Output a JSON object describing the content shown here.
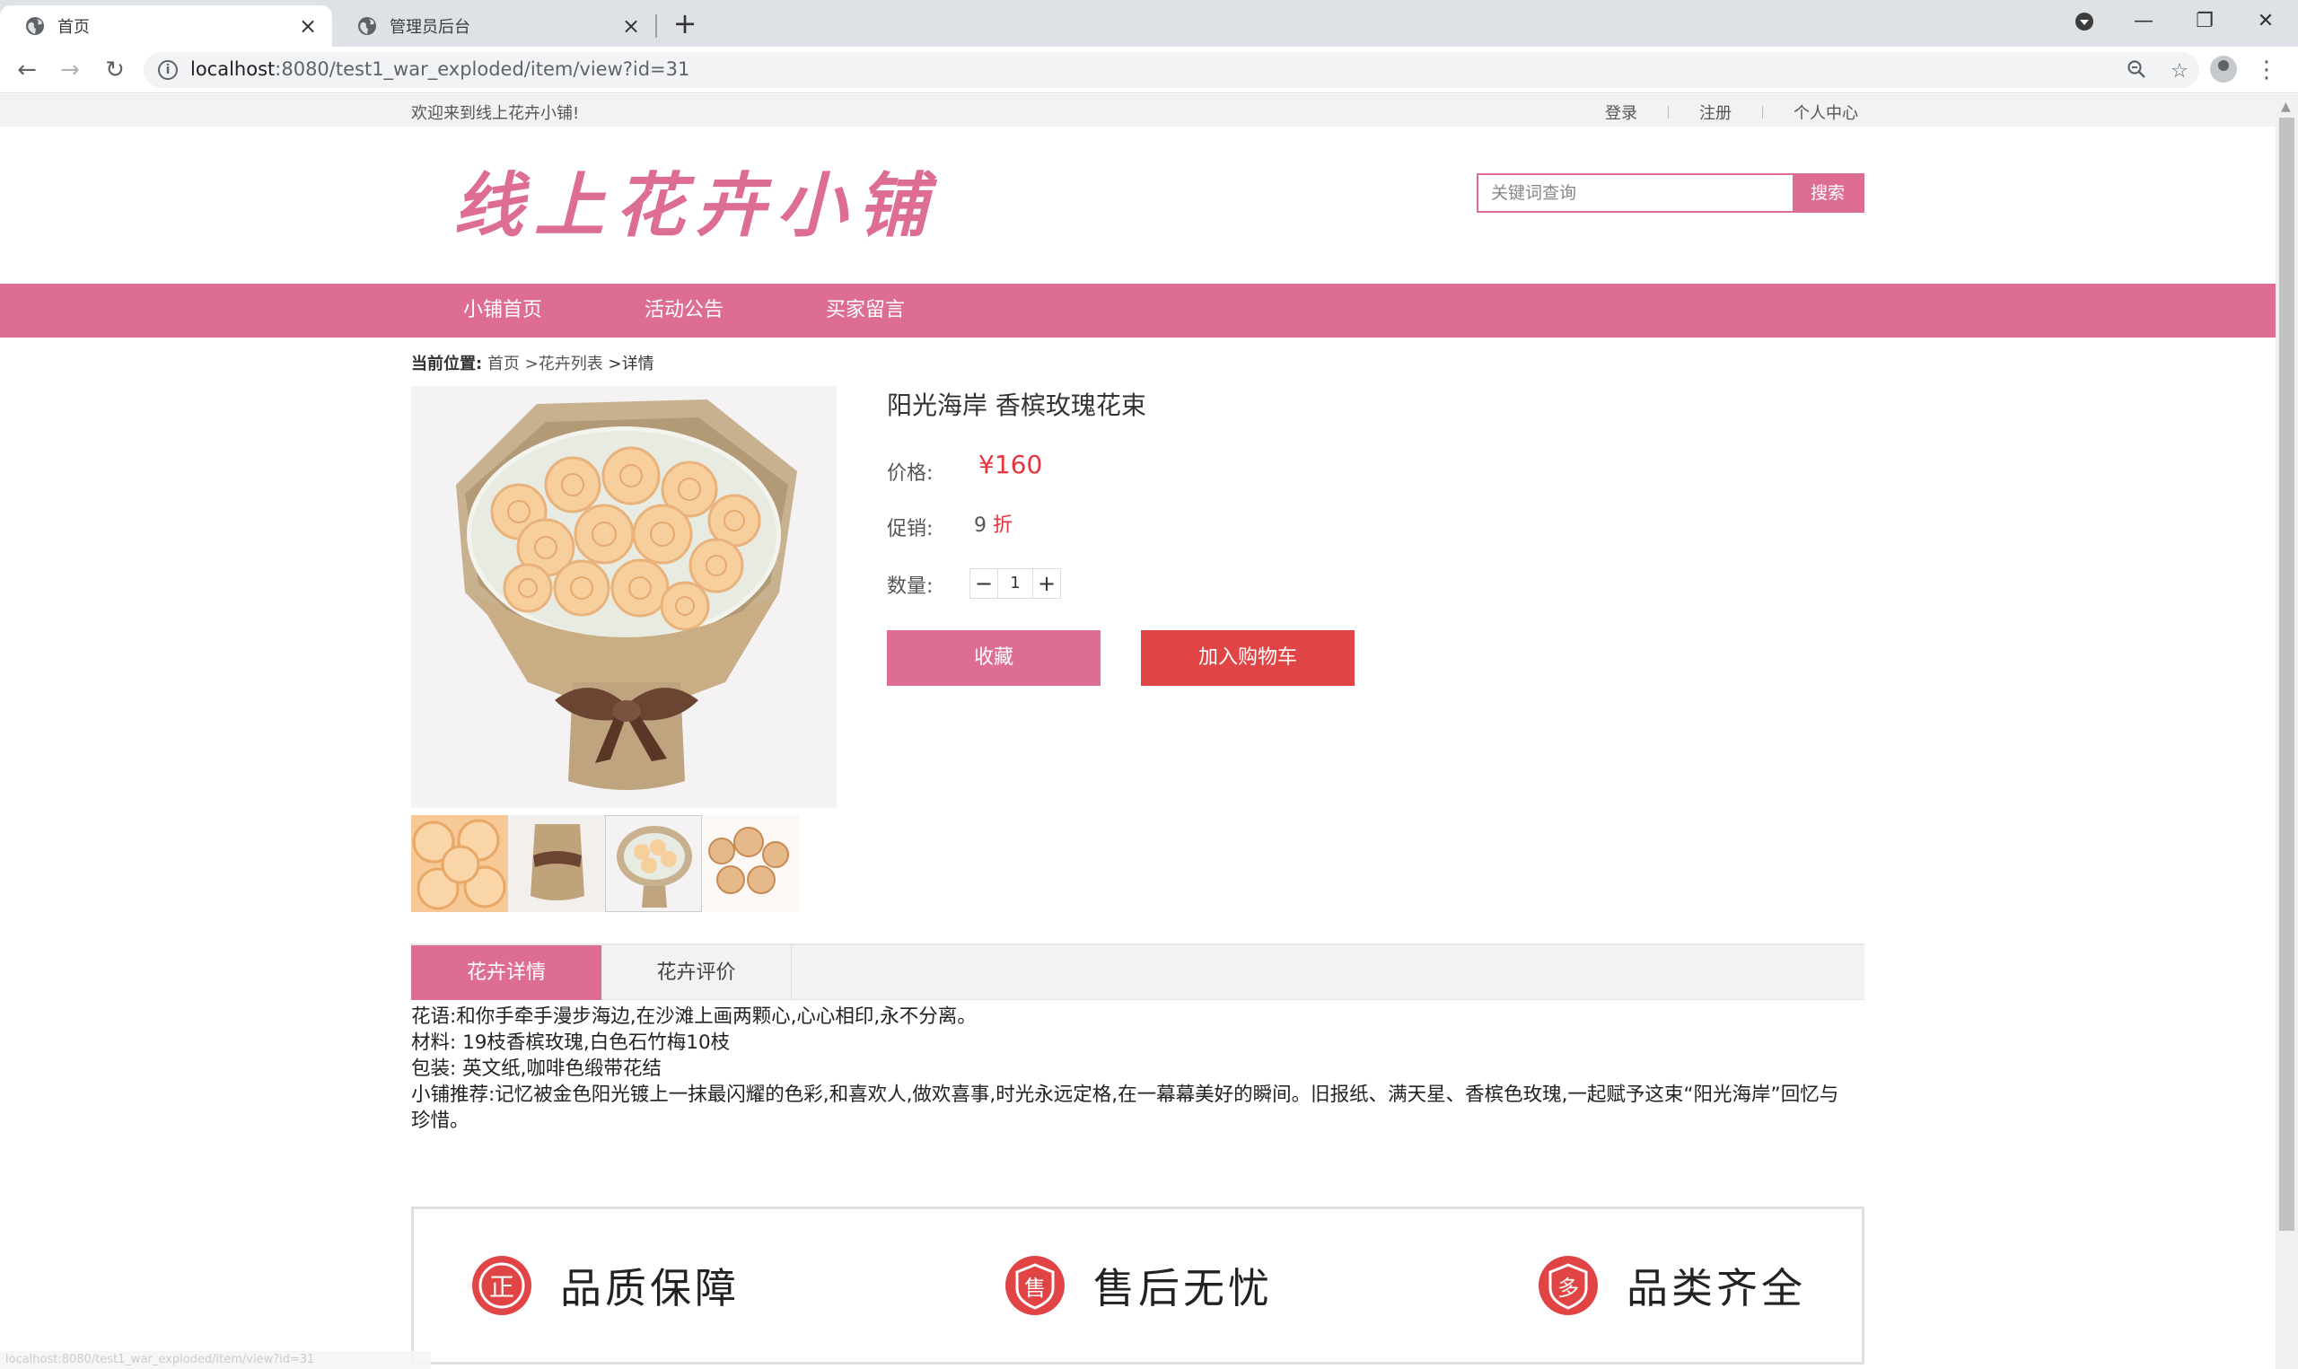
{
  "browser": {
    "tabs": [
      {
        "title": "首页",
        "active": true
      },
      {
        "title": "管理员后台",
        "active": false
      }
    ],
    "url_host": "localhost",
    "url_rest": ":8080/test1_war_exploded/item/view?id=31",
    "window_controls": {
      "minimize": "—",
      "restore": "❐",
      "close": "✕"
    }
  },
  "site": {
    "welcome": "欢迎来到线上花卉小铺!",
    "top_links": [
      "登录",
      "注册",
      "个人中心"
    ],
    "logo": "线上花卉小铺",
    "search": {
      "placeholder": "关键词查询",
      "button": "搜索"
    },
    "nav": [
      "小铺首页",
      "活动公告",
      "买家留言"
    ],
    "brand_color": "#dd6e91"
  },
  "breadcrumb": {
    "label": "当前位置:",
    "items": [
      "首页",
      ">花卉列表",
      ">详情"
    ]
  },
  "product": {
    "title": "阳光海岸 香槟玫瑰花束",
    "price_label": "价格:",
    "price": "¥160",
    "promo_label": "促销:",
    "promo_value": "9",
    "promo_unit": "折",
    "qty_label": "数量:",
    "qty": "1",
    "minus": "−",
    "plus": "+",
    "fav_button": "收藏",
    "cart_button": "加入购物车",
    "price_color": "#e8323c"
  },
  "tabs": [
    "花卉详情",
    "花卉评价"
  ],
  "details": [
    "花语:和你手牵手漫步海边,在沙滩上画两颗心,心心相印,永不分离。",
    "材料: 19枝香槟玫瑰,白色石竹梅10枝",
    "包装: 英文纸,咖啡色缎带花结",
    "小铺推荐:记忆被金色阳光镀上一抹最闪耀的色彩,和喜欢人,做欢喜事,时光永远定格,在一幕幕美好的瞬间。旧报纸、满天星、香槟色玫瑰,一起赋予这束“阳光海岸”回忆与珍惜。"
  ],
  "guarantees": [
    {
      "icon": "正",
      "label": "品质保障"
    },
    {
      "icon": "售",
      "label": "售后无忧"
    },
    {
      "icon": "多",
      "label": "品类齐全"
    }
  ],
  "status_bar": "localhost:8080/test1_war_exploded/item/view?id=31"
}
